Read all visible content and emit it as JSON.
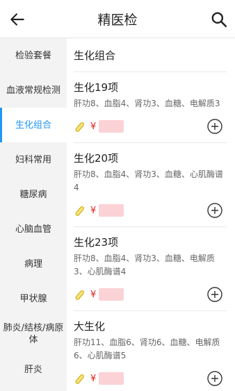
{
  "header": {
    "title": "精医检"
  },
  "sidebar": {
    "items": [
      {
        "label": "检验套餐"
      },
      {
        "label": "血液常规检测"
      },
      {
        "label": "生化组合"
      },
      {
        "label": "妇科常用"
      },
      {
        "label": "糖尿病"
      },
      {
        "label": "心脑血管"
      },
      {
        "label": "病理"
      },
      {
        "label": "甲状腺"
      },
      {
        "label": "肺炎/结核/病原体"
      },
      {
        "label": "肝炎"
      }
    ],
    "active_index": 2
  },
  "main": {
    "section_title": "生化组合",
    "items": [
      {
        "name": "生化19项",
        "desc": "肝功8、血脂4、肾功3、血糖、电解质3",
        "currency": "¥"
      },
      {
        "name": "生化20项",
        "desc": "肝功8、血脂4、肾功3、血糖、心肌酶谱4",
        "currency": "¥"
      },
      {
        "name": "生化23项",
        "desc": "肝功8、血脂4、肾功3、血糖、电解质3、心肌酶谱4",
        "currency": "¥"
      },
      {
        "name": "大生化",
        "desc": "肝功11、血脂6、肾功6、血糖、电解质6、心肌酶谱5",
        "currency": "¥"
      }
    ]
  },
  "colors": {
    "accent": "#2196f3",
    "price": "#e02020",
    "tube": "#e8c020"
  }
}
